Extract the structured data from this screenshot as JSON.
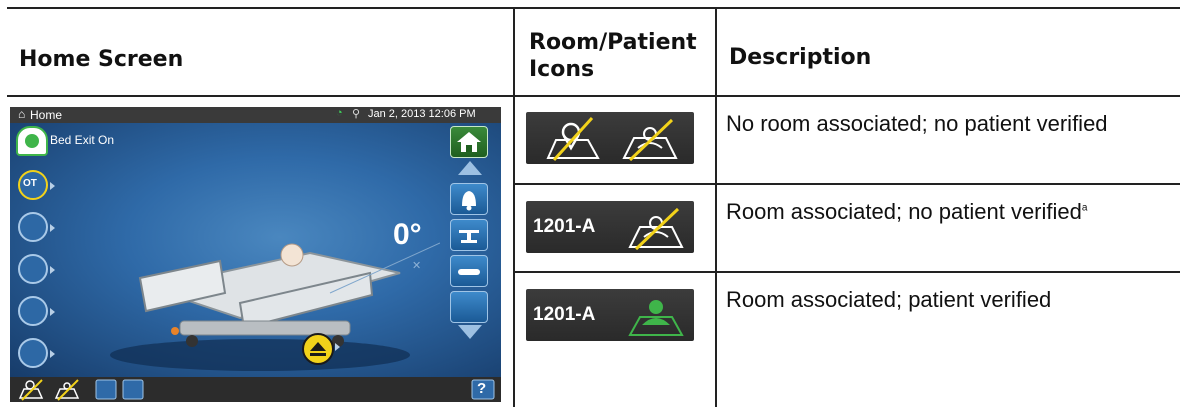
{
  "headers": {
    "home_screen": "Home Screen",
    "icons_line1": "Room/Patient",
    "icons_line2": "Icons",
    "description": "Description"
  },
  "rows": [
    {
      "room_label": "",
      "description": "No room associated; no patient verified",
      "footnote": ""
    },
    {
      "room_label": "1201-A",
      "description": "Room associated; no patient verified",
      "footnote": "a"
    },
    {
      "room_label": "1201-A",
      "description": "Room associated; patient verified",
      "footnote": ""
    }
  ],
  "home_screen": {
    "title": "Home",
    "datetime": "Jan 2, 2013 12:06 PM",
    "alert_label": "Bed Exit On",
    "ot_label": "OT",
    "angle": "0°",
    "help_label": "?",
    "left_icons": [
      "ot-icon",
      "patient-position-icon",
      "bed-angle-icon",
      "turn-assist-icon",
      "surface-icon"
    ],
    "right_icons": [
      "home-icon",
      "scroll-up-icon",
      "alarm-bell-icon",
      "scale-icon",
      "surface-therapy-icon",
      "bed-motion-icon",
      "scroll-down-icon"
    ],
    "bottom_icons": [
      "room-status-icon",
      "patient-status-icon",
      "lockout-icon",
      "lock-icon",
      "help-icon"
    ],
    "colors": {
      "alert_green": "#3fb54a",
      "accent_yellow": "#f2d21a",
      "screen_blue": "#2f6aa8"
    }
  }
}
